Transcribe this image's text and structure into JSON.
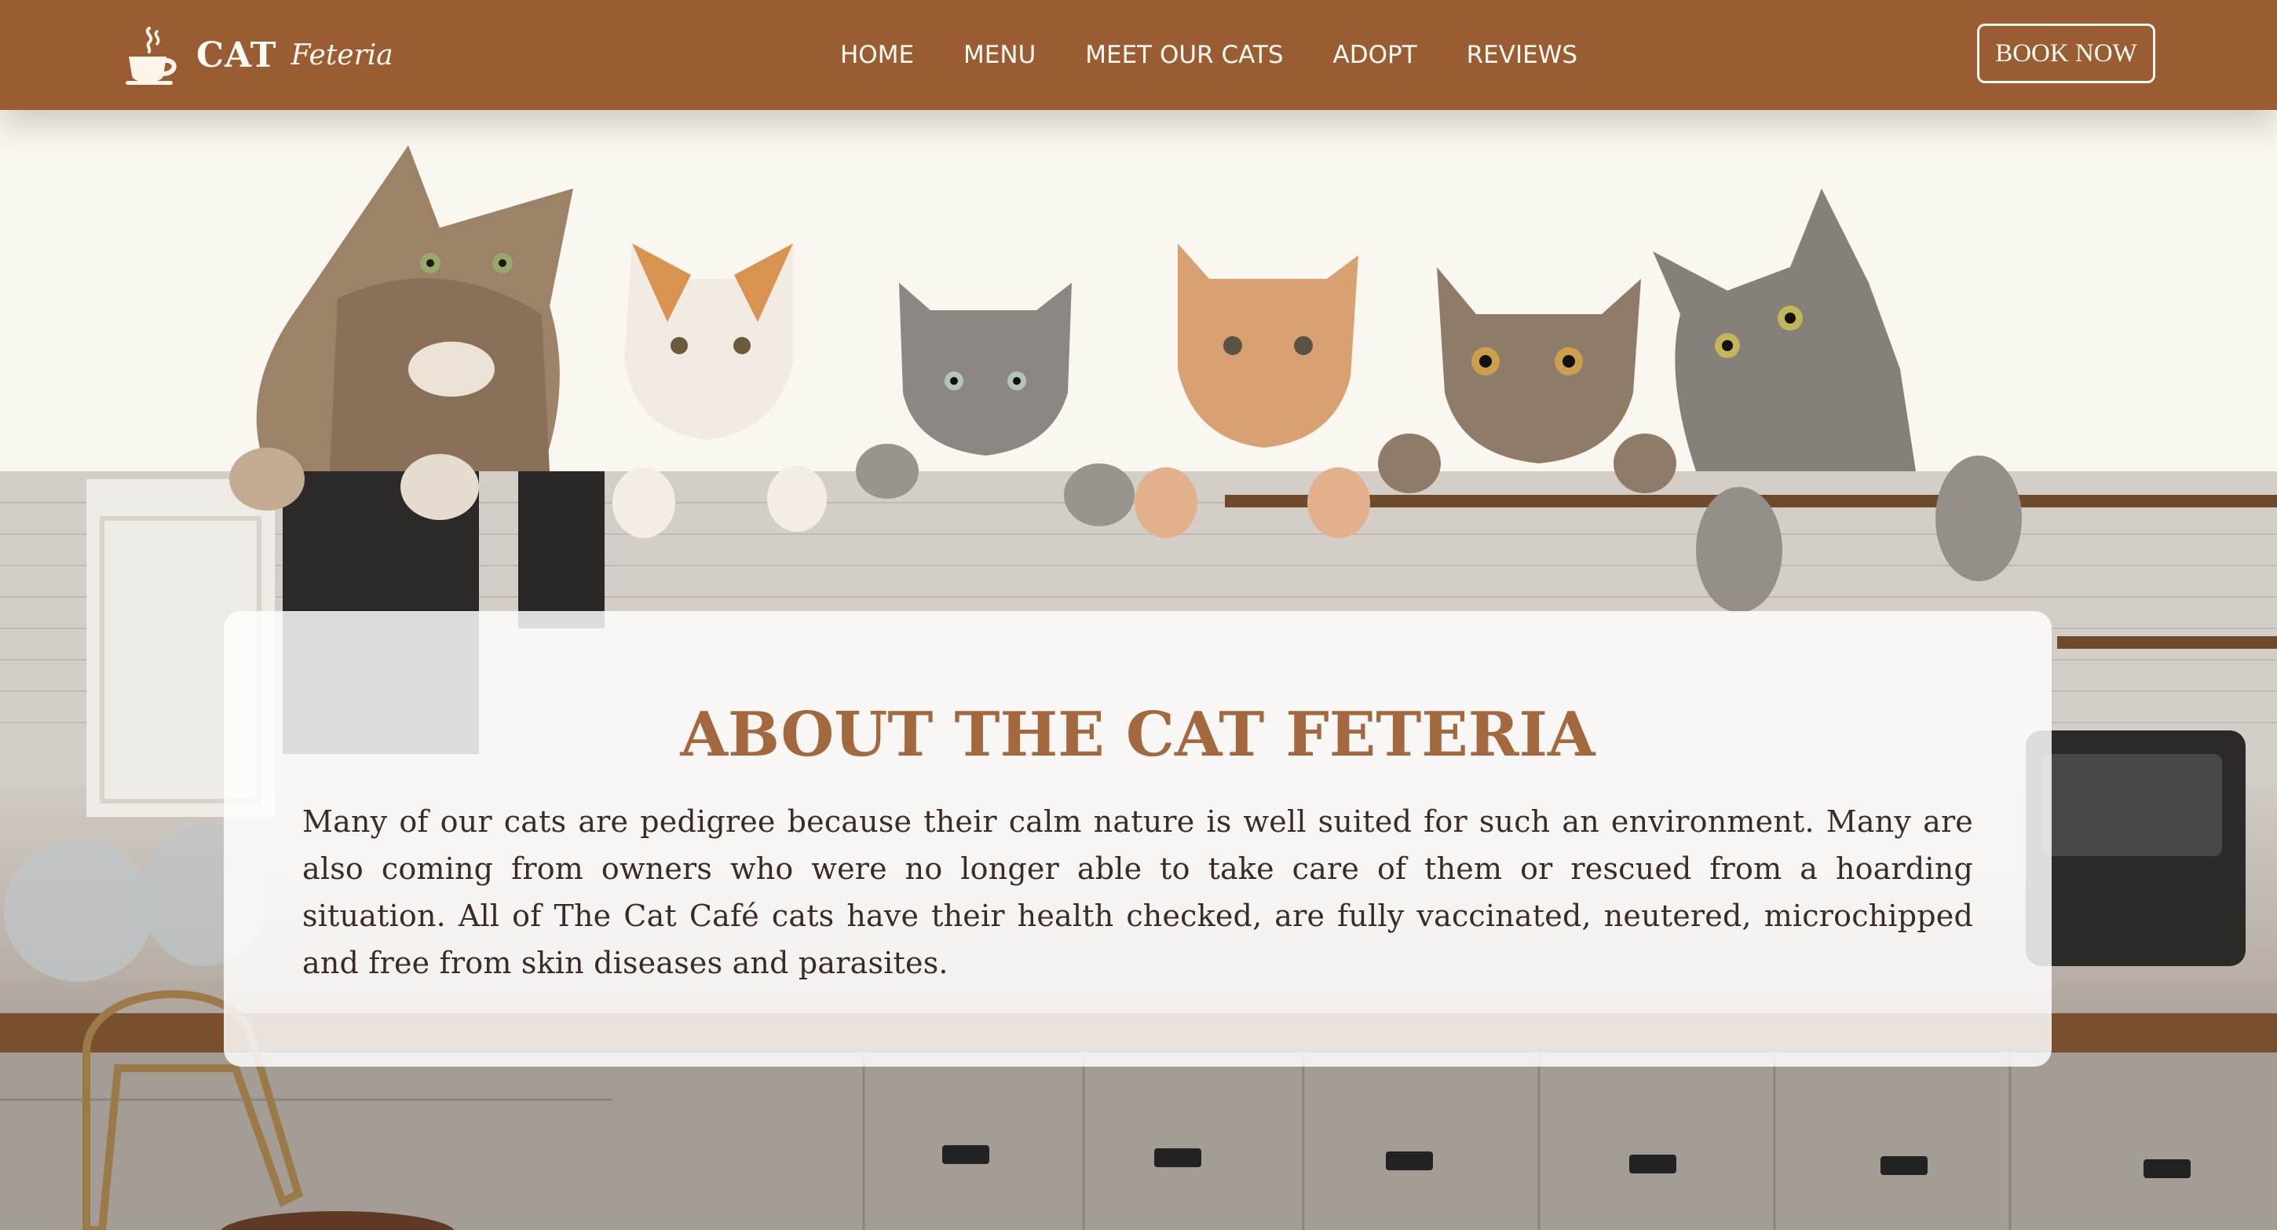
{
  "brand": {
    "name": "CAT",
    "tagline": "Feteria",
    "icon": "coffee-cup-icon"
  },
  "nav": {
    "links": [
      "HOME",
      "MENU",
      "MEET OUR CATS",
      "ADOPT",
      "REVIEWS"
    ],
    "cta": "BOOK NOW"
  },
  "hero": {
    "image": "cats peeking over cafe counter"
  },
  "about": {
    "title": "ABOUT THE CAT FETERIA",
    "body": "Many of our cats are pedigree because their calm nature is well suited for such an environment. Many are also coming from owners who were no longer able to take care of them or rescued from a hoarding situation. All of The Cat Café cats have their health checked, are fully vaccinated, neutered, microchipped and free from skin diseases and parasites."
  },
  "colors": {
    "nav_bg": "#995c33",
    "nav_text": "#fffaf2",
    "title": "#a3683d",
    "body_text": "#3a2c22",
    "page_bg": "#faf7f1"
  }
}
